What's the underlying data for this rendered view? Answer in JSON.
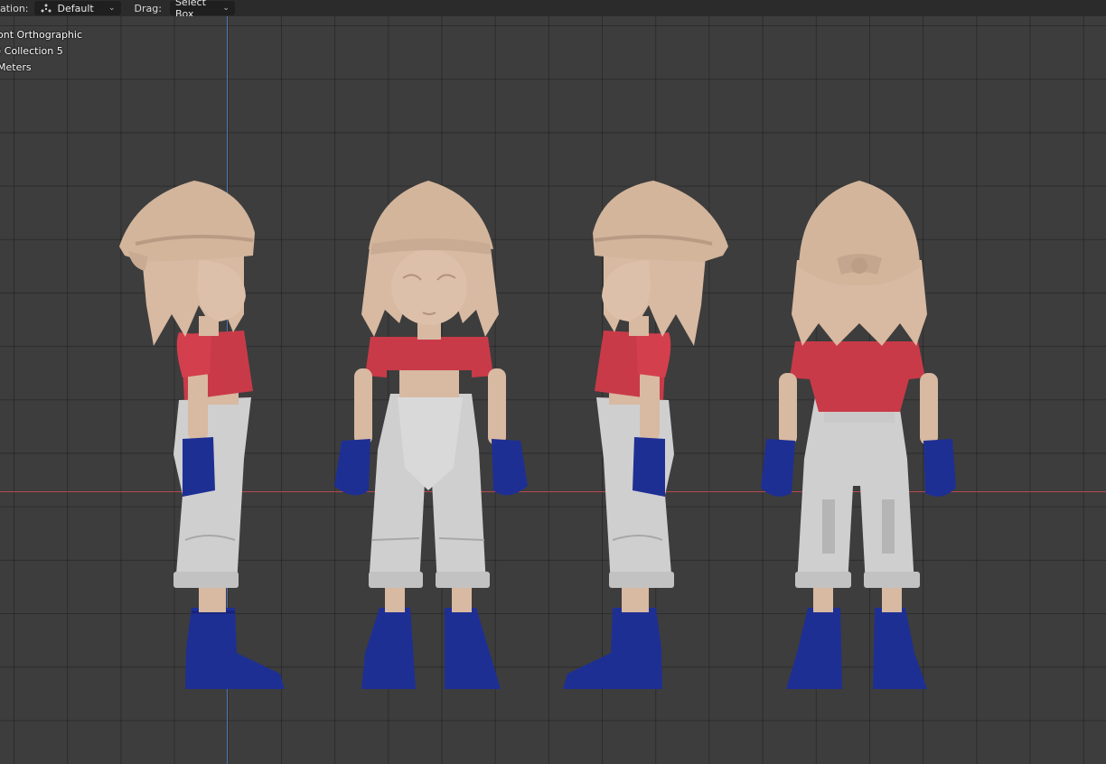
{
  "header": {
    "transform_pivot_label": "ation:",
    "transform_pivot_value": "Default",
    "drag_label": "Drag:",
    "drag_value": "Select Box"
  },
  "overlay": {
    "view_name": "ont Orthographic",
    "collection": ") Collection 5",
    "units": "Meters"
  },
  "colors": {
    "background": "#3d3d3d",
    "header": "#2b2b2b",
    "x_axis": "#b5484d",
    "z_axis": "#4e79b3",
    "skin": "#d8b9a1",
    "shirt": "#c93a48",
    "pants": "#cfcfcf",
    "gloves_boots": "#1e2f94"
  },
  "views": [
    "side-left",
    "front",
    "side-right",
    "back"
  ]
}
